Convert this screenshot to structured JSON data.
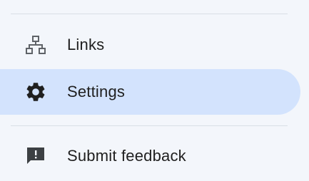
{
  "menu": {
    "items": [
      {
        "label": "Links",
        "icon": "sitemap-icon",
        "active": false
      },
      {
        "label": "Settings",
        "icon": "gear-icon",
        "active": true
      },
      {
        "label": "Submit feedback",
        "icon": "feedback-icon",
        "active": false
      }
    ]
  },
  "colors": {
    "background": "#f3f6fb",
    "active_background": "#d3e3fd",
    "divider": "#d9dee6",
    "text": "#1f1f1f",
    "icon_muted": "#5f6368",
    "icon_dark": "#1f1f1f"
  }
}
